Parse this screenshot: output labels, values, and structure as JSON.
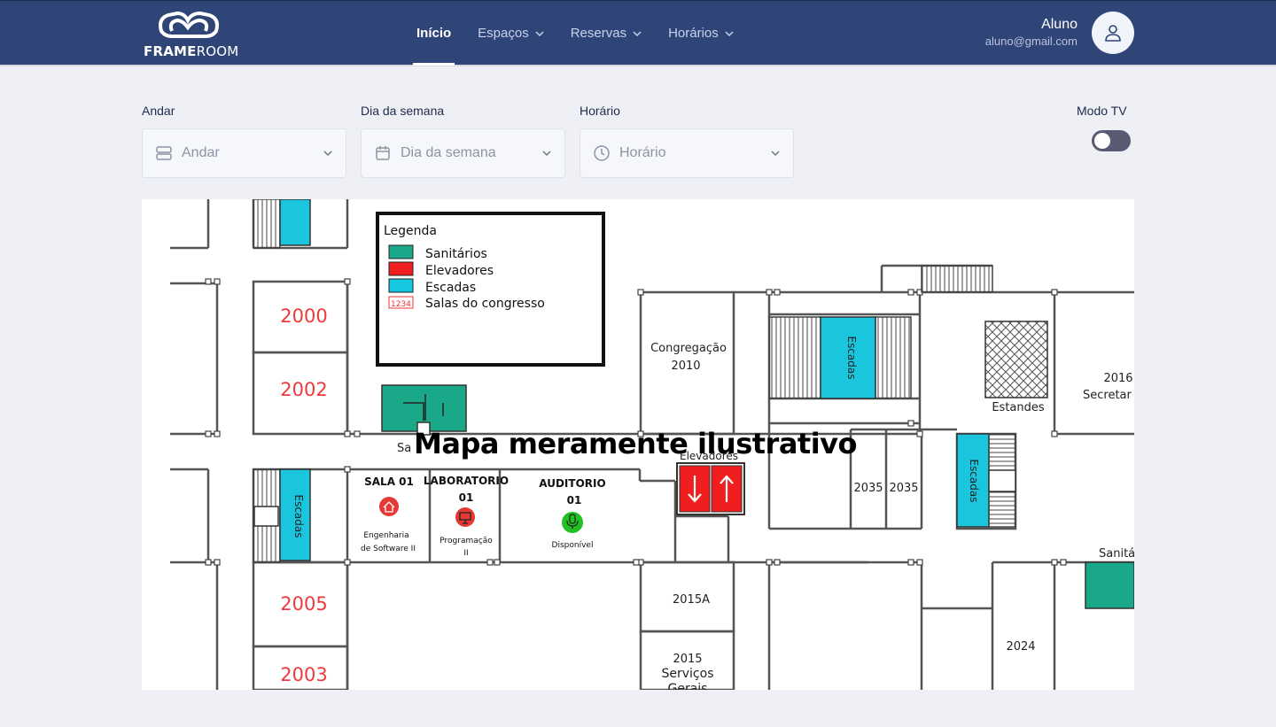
{
  "app": {
    "logo_bold": "FRAME",
    "logo_light": "ROOM"
  },
  "nav": {
    "items": [
      {
        "label": "Início"
      },
      {
        "label": "Espaços"
      },
      {
        "label": "Reservas"
      },
      {
        "label": "Horários"
      }
    ]
  },
  "user": {
    "name": "Aluno",
    "email": "aluno@gmail.com"
  },
  "filters": {
    "floor": {
      "label": "Andar",
      "placeholder": "Andar"
    },
    "weekday": {
      "label": "Dia da semana",
      "placeholder": "Dia da semana"
    },
    "time": {
      "label": "Horário",
      "placeholder": "Horário"
    },
    "tv_mode": {
      "label": "Modo TV",
      "enabled": false
    }
  },
  "map": {
    "caption": "Mapa meramente ilustrativo",
    "legend": {
      "title": "Legenda",
      "items": [
        {
          "label": "Sanitários",
          "color": "#1aa88a"
        },
        {
          "label": "Elevadores",
          "color": "#f01e1e"
        },
        {
          "label": "Escadas",
          "color": "#14c8e0"
        },
        {
          "label": "Salas do congresso",
          "sample": "1234"
        }
      ]
    },
    "rooms": {
      "r2000": "2000",
      "r2002": "2002",
      "r2005": "2005",
      "r2003": "2003",
      "congregacao_name": "Congregação",
      "congregacao_num": "2010",
      "secretaria_num": "2016",
      "secretaria_name": "Secretar",
      "estandes": "Estandes",
      "r2035a": "2035",
      "r2035b": "2035",
      "r2015a": "2015A",
      "r2015_num": "2015",
      "r2015_name1": "Serviços",
      "r2015_name2": "Gerais",
      "r2024": "2024",
      "elevadores": "Elevadores",
      "escadas_label": "Escadas",
      "sanitarios_cut": "Sanitá",
      "sanitarios_center": "Sa"
    },
    "spaces": [
      {
        "title_l1": "SALA 01",
        "title_l2": "",
        "sub_l1": "Engenharia",
        "sub_l2": "de Software II",
        "status_color": "#e53935",
        "icon": "home-icon"
      },
      {
        "title_l1": "LABORATORIO",
        "title_l2": "01",
        "sub_l1": "Programação",
        "sub_l2": "II",
        "status_color": "#e53935",
        "icon": "monitor-icon"
      },
      {
        "title_l1": "AUDITORIO",
        "title_l2": "01",
        "sub_l1": "Disponível",
        "sub_l2": "",
        "status_color": "#22c022",
        "icon": "microphone-icon"
      }
    ]
  }
}
